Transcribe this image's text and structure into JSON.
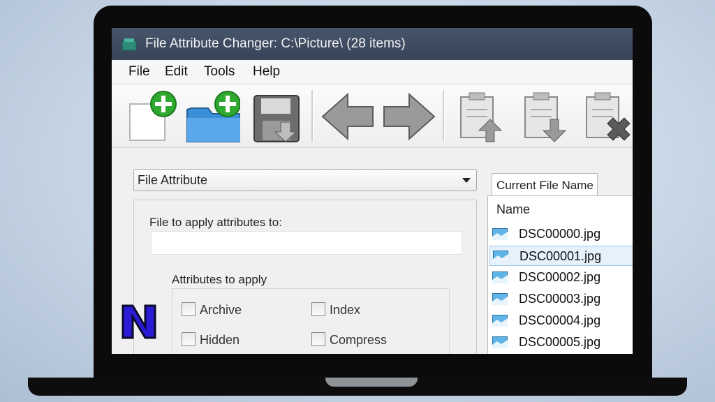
{
  "window": {
    "title": "File Attribute Changer: C:\\Picture\\ (28 items)"
  },
  "menu": [
    "File",
    "Edit",
    "Tools",
    "Help"
  ],
  "toolbar": {
    "buttons": [
      "add-file",
      "add-folder",
      "save",
      "back",
      "forward",
      "clipboard-up",
      "clipboard-down",
      "clipboard-delete"
    ]
  },
  "left_panel": {
    "dropdown_value": "File Attribute",
    "file_label": "File to apply attributes to:",
    "file_value": "",
    "attributes_legend": "Attributes to apply",
    "checkboxes": [
      {
        "label": "Archive",
        "checked": false
      },
      {
        "label": "Index",
        "checked": false
      },
      {
        "label": "Hidden",
        "checked": false
      },
      {
        "label": "Compress",
        "checked": false
      }
    ]
  },
  "right_panel": {
    "tab_label": "Current File Name",
    "column_header": "Name",
    "files": [
      "DSC00000.jpg",
      "DSC00001.jpg",
      "DSC00002.jpg",
      "DSC00003.jpg",
      "DSC00004.jpg",
      "DSC00005.jpg"
    ],
    "selected_index": 1
  },
  "overlay": {
    "logo_letter": "N",
    "logo_color": "#2a1bd6"
  },
  "colors": {
    "titlebar": "#3f4c62",
    "toolbar_green": "#2fa82f",
    "folder_blue": "#3a8fd8",
    "arrow_gray": "#8c8c8c"
  }
}
